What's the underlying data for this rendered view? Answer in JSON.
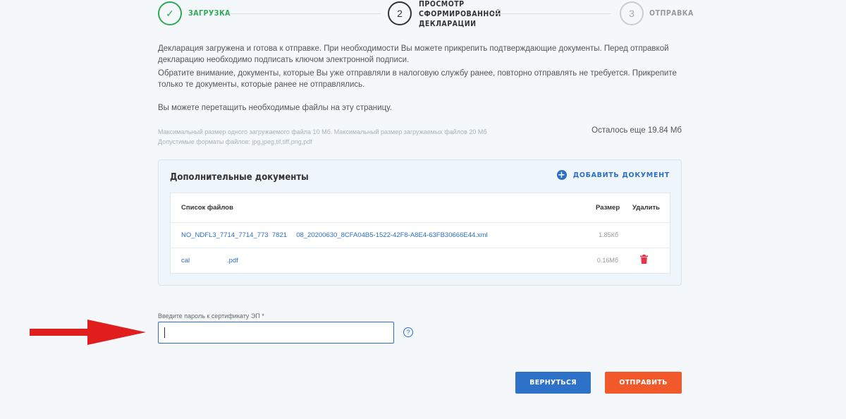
{
  "stepper": {
    "steps": [
      {
        "number": "✓",
        "label": "ЗАГРУЗКА",
        "state": "done"
      },
      {
        "number": "2",
        "label_lines": [
          "ПРОСМОТР",
          "СФОРМИРОВАННОЙ",
          "ДЕКЛАРАЦИИ"
        ],
        "state": "active"
      },
      {
        "number": "3",
        "label": "ОТПРАВКА",
        "state": "pending"
      }
    ]
  },
  "info": {
    "p1": "Декларация загружена и готова к отправке. При необходимости Вы можете прикрепить подтверждающие документы. Перед отправкой декларацию необходимо подписать ключом электронной подписи.",
    "p2": "Обратите внимание, документы, которые Вы уже отправляли в налоговую службу ранее, повторно отправлять не требуется. Прикрепите только те документы, которые ранее не отправлялись.",
    "p3": "Вы можете перетащить необходимые файлы на эту страницу.",
    "limit_size": "Максимальный размер одного загружаемого файла 10 Мб. Максимальный размер загружаемых файлов 20 Мб",
    "limit_formats": "Допустимые форматы файлов: jpg,jpeg,tif,tiff,png,pdf",
    "remaining": "Осталось еще 19.84 Мб"
  },
  "documents": {
    "title": "Дополнительные документы",
    "add_label": "ДОБАВИТЬ ДОКУМЕНТ",
    "columns": {
      "name": "Список файлов",
      "size": "Размер",
      "delete": "Удалить"
    },
    "files": [
      {
        "name": "NO_NDFL3_7714_7714_773  7821     08_20200630_8CFA04B5-1522-42F8-A8E4-63FB30666E44.xml",
        "size": "1.85Кб"
      },
      {
        "name": "cal                    .pdf",
        "size": "0.16Мб"
      }
    ]
  },
  "password": {
    "label": "Введите пароль к сертификату ЭП *",
    "value": "",
    "help": "?"
  },
  "buttons": {
    "back": "ВЕРНУТЬСЯ",
    "send": "ОТПРАВИТЬ"
  },
  "colors": {
    "success": "#2eaa54",
    "primary": "#2d72c8",
    "accent": "#f1592a",
    "annotation_arrow": "#e01e1e",
    "delete": "#e8334a"
  }
}
